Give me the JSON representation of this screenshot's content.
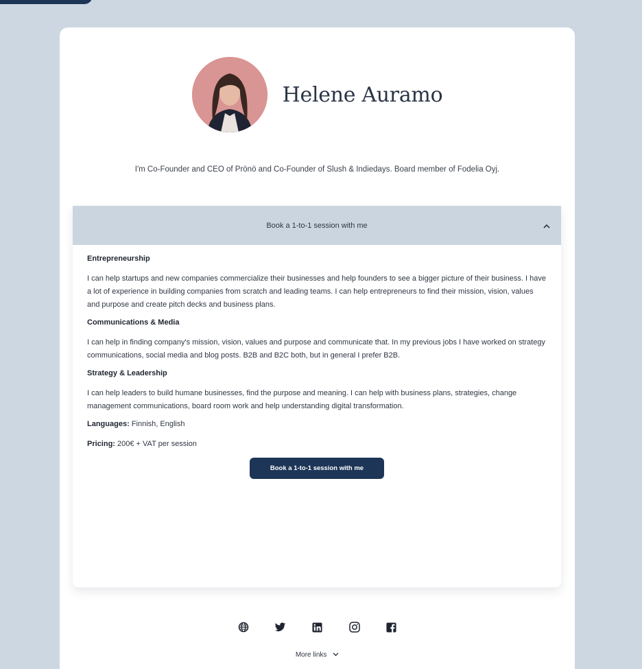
{
  "profile": {
    "name": "Helene Auramo",
    "bio": "I'm Co-Founder and CEO of Prönö and Co-Founder of Slush & Indiedays. Board member of Fodelia Oyj."
  },
  "booking": {
    "header_label": "Book a 1-to-1 session with me",
    "sections": [
      {
        "title": "Entrepreneurship",
        "text": "I can help startups and new companies commercialize their businesses and help founders to see a bigger picture of their business. I have a lot of experience in building companies from scratch and leading teams. I can help entrepreneurs to find their mission, vision, values and purpose and create pitch decks and business plans."
      },
      {
        "title": "Communications & Media",
        "text": "I can help in finding company's mission, vision, values and purpose and communicate that. In my previous jobs I have worked on strategy communications, social media and blog posts. B2B and B2C both, but in general I prefer B2B."
      },
      {
        "title": "Strategy & Leadership",
        "text": "I can help leaders to build humane businesses, find the purpose and meaning. I can help with business plans, strategies, change management communications, board room work and help understanding digital transformation."
      }
    ],
    "languages_label": "Languages:",
    "languages_value": "Finnish, English",
    "pricing_label": "Pricing:",
    "pricing_value": "200€ + VAT per session",
    "button_label": "Book a 1-to-1 session with me"
  },
  "footer": {
    "social_icons": [
      "globe-icon",
      "twitter-icon",
      "linkedin-icon",
      "instagram-icon",
      "facebook-icon"
    ],
    "more_links_label": "More links"
  },
  "colors": {
    "background": "#cdd7e1",
    "accent": "#1d3557",
    "accordion_header": "#cbd5e0",
    "avatar_bg": "#d99593"
  }
}
